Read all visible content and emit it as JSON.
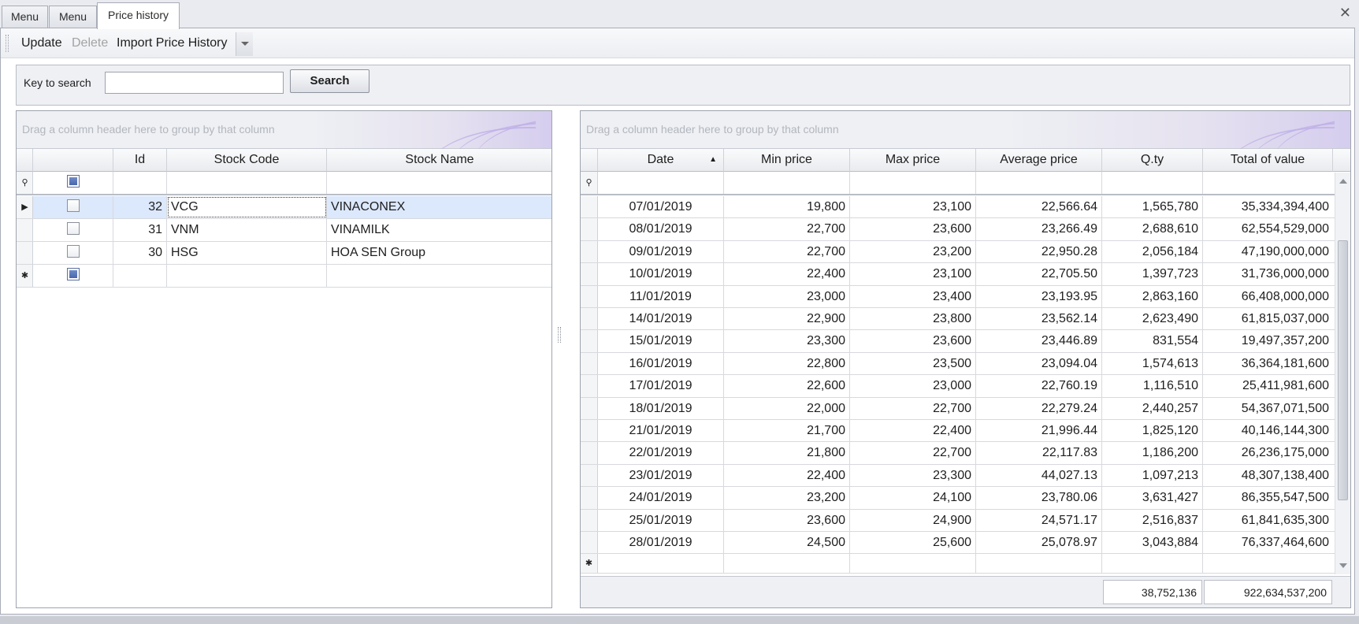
{
  "tabs": [
    {
      "label": "Menu"
    },
    {
      "label": "Menu"
    },
    {
      "label": "Price history"
    }
  ],
  "toolbar": {
    "update_label": "Update",
    "delete_label": "Delete",
    "import_label": "Import Price History"
  },
  "search": {
    "label": "Key to search",
    "value": "",
    "button_label": "Search"
  },
  "stocks_grid": {
    "group_hint": "Drag a column header here to group by that column",
    "columns": {
      "id": "Id",
      "code": "Stock Code",
      "name": "Stock Name"
    },
    "rows": [
      {
        "id": "32",
        "code": "VCG",
        "name": "VINACONEX",
        "selected": true
      },
      {
        "id": "31",
        "code": "VNM",
        "name": "VINAMILK",
        "selected": false
      },
      {
        "id": "30",
        "code": "HSG",
        "name": "HOA SEN Group",
        "selected": false
      }
    ]
  },
  "history_grid": {
    "group_hint": "Drag a column header here to group by that column",
    "columns": {
      "date": "Date",
      "min": "Min price",
      "max": "Max price",
      "avg": "Average price",
      "qty": "Q.ty",
      "total": "Total of value"
    },
    "rows": [
      {
        "date": "07/01/2019",
        "min": "19,800",
        "max": "23,100",
        "avg": "22,566.64",
        "qty": "1,565,780",
        "total": "35,334,394,400"
      },
      {
        "date": "08/01/2019",
        "min": "22,700",
        "max": "23,600",
        "avg": "23,266.49",
        "qty": "2,688,610",
        "total": "62,554,529,000"
      },
      {
        "date": "09/01/2019",
        "min": "22,700",
        "max": "23,200",
        "avg": "22,950.28",
        "qty": "2,056,184",
        "total": "47,190,000,000"
      },
      {
        "date": "10/01/2019",
        "min": "22,400",
        "max": "23,100",
        "avg": "22,705.50",
        "qty": "1,397,723",
        "total": "31,736,000,000"
      },
      {
        "date": "11/01/2019",
        "min": "23,000",
        "max": "23,400",
        "avg": "23,193.95",
        "qty": "2,863,160",
        "total": "66,408,000,000"
      },
      {
        "date": "14/01/2019",
        "min": "22,900",
        "max": "23,800",
        "avg": "23,562.14",
        "qty": "2,623,490",
        "total": "61,815,037,000"
      },
      {
        "date": "15/01/2019",
        "min": "23,300",
        "max": "23,600",
        "avg": "23,446.89",
        "qty": "831,554",
        "total": "19,497,357,200"
      },
      {
        "date": "16/01/2019",
        "min": "22,800",
        "max": "23,500",
        "avg": "23,094.04",
        "qty": "1,574,613",
        "total": "36,364,181,600"
      },
      {
        "date": "17/01/2019",
        "min": "22,600",
        "max": "23,000",
        "avg": "22,760.19",
        "qty": "1,116,510",
        "total": "25,411,981,600"
      },
      {
        "date": "18/01/2019",
        "min": "22,000",
        "max": "22,700",
        "avg": "22,279.24",
        "qty": "2,440,257",
        "total": "54,367,071,500"
      },
      {
        "date": "21/01/2019",
        "min": "21,700",
        "max": "22,400",
        "avg": "21,996.44",
        "qty": "1,825,120",
        "total": "40,146,144,300"
      },
      {
        "date": "22/01/2019",
        "min": "21,800",
        "max": "22,700",
        "avg": "22,117.83",
        "qty": "1,186,200",
        "total": "26,236,175,000"
      },
      {
        "date": "23/01/2019",
        "min": "22,400",
        "max": "23,300",
        "avg": "44,027.13",
        "qty": "1,097,213",
        "total": "48,307,138,400"
      },
      {
        "date": "24/01/2019",
        "min": "23,200",
        "max": "24,100",
        "avg": "23,780.06",
        "qty": "3,631,427",
        "total": "86,355,547,500"
      },
      {
        "date": "25/01/2019",
        "min": "23,600",
        "max": "24,900",
        "avg": "24,571.17",
        "qty": "2,516,837",
        "total": "61,841,635,300"
      },
      {
        "date": "28/01/2019",
        "min": "24,500",
        "max": "25,600",
        "avg": "25,078.97",
        "qty": "3,043,884",
        "total": "76,337,464,600"
      }
    ],
    "totals": {
      "qty": "38,752,136",
      "total": "922,634,537,200"
    }
  },
  "colors": {
    "selection": "#dce8fb",
    "header_bg": "#e9ebef",
    "border": "#9ea3ad"
  },
  "icons": [
    "close-icon",
    "filter-icon",
    "row-indicator-icon",
    "new-row-icon",
    "sort-ascending-icon",
    "dropdown-arrow-icon"
  ]
}
